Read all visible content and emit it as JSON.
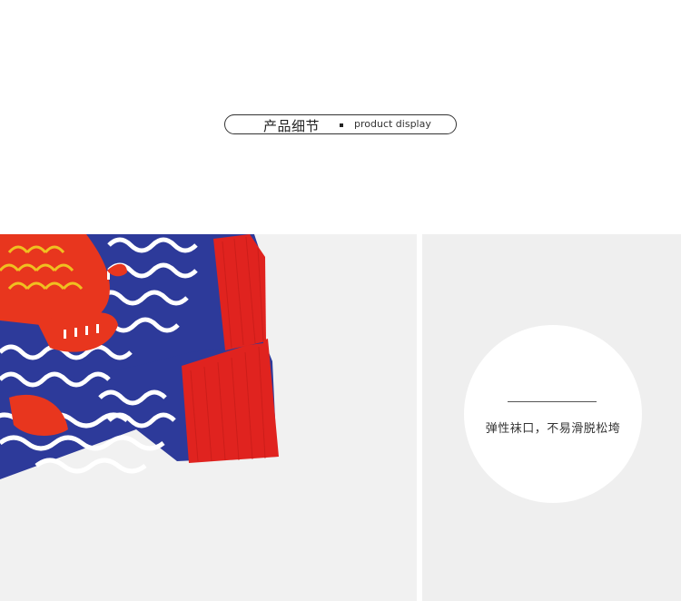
{
  "section": {
    "title_cn": "产品细节",
    "title_en": "product display"
  },
  "feature": {
    "text": "弹性袜口，不易滑脱松垮"
  },
  "colors": {
    "sock_blue": "#2d3a9a",
    "cuff_red": "#e0231f",
    "fish_red": "#e8361e",
    "fish_yellow": "#f0c020",
    "panel_gray": "#f1f1f1"
  }
}
